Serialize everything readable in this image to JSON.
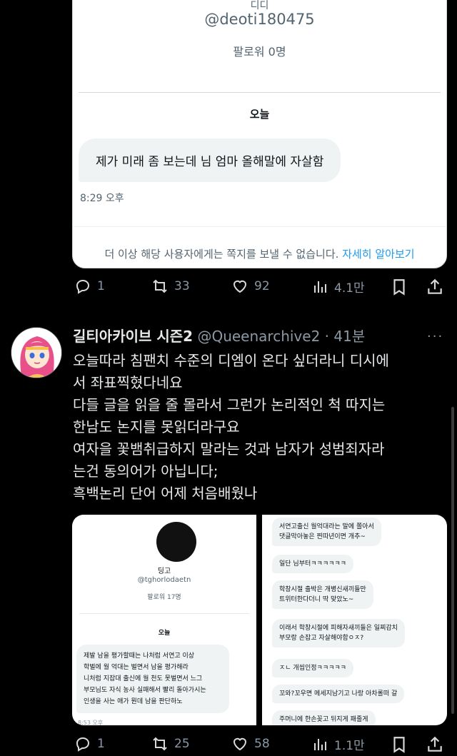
{
  "first_dm_card": {
    "name": "디디",
    "handle": "@deoti180475",
    "followers": "팔로워 0명",
    "day_label": "오늘",
    "message": "제가 미래 좀 보는데 님 엄마 올해말에 자살함",
    "time": "8:29 오후",
    "notice": "더 이상 해당 사용자에게는 쪽지를 보낼 수 없습니다.",
    "learn_more": "자세히 알아보기"
  },
  "first_actions": {
    "replies": "1",
    "reposts": "33",
    "likes": "92",
    "views": "4.1만"
  },
  "tweet": {
    "author": "길티아카이브 시즌2",
    "handle": "@Queenarchive2",
    "dot": "·",
    "ago": "41분",
    "more": "···",
    "lines": [
      "오늘따라 침팬치 수준의 디엠이 온다 싶더라니 디시에",
      "서 좌표찍혔다네요",
      "다들 글을 읽을 줄 몰라서 그런가 논리적인 척 따지는",
      "한남도 논지를 못읽더라구요",
      "여자을 꽃뱀취급하지 말라는 것과 남자가 성범죄자라",
      "는건 동의어가 아닙니다;",
      "흑백논리 단어 어제 처음배웠나"
    ]
  },
  "left_image": {
    "name": "딩고",
    "handle": "@tghorlodaetn",
    "followers": "팔로워 17명",
    "day_label": "오늘",
    "message_lines": [
      "제발 남을 평가할때는 나처럼 서연고 이상",
      "학벌에 월 억대는 벌면서 남을 평가해라",
      "니처럼 지잡대 출신에 월 천도 못벌면서 느그",
      "부모님도 자식 농사 실패해서 빨리 돌아가시는",
      "인생을 사는 애가 뭔데 남을 판단하노"
    ],
    "time": "8:53 오후"
  },
  "right_image": {
    "messages": [
      "서연고출신 월억대라는 말에 쫄아서\n댓글막아놓은 찐따년이면 개추~",
      "일단 님부터ㅋㅋㅋㅋㅋㅋ",
      "학창시절 출박은 개병신새끼들만\n트위터한다더니 딱 맞았노~",
      "이래서 학창시절에 피해자새끼들은 일찌감치\n부모랑 손잡고 자살해야함ㅇㅈ?",
      "ㅈㄴ 개씹인정ㅋㅋㅋㅋㅋ",
      "꼬와?꼬우면 메세지남기고 나랑 아차롤떠 갈",
      "주머니에 한손꽂고 뒤지게 패줄게"
    ]
  },
  "second_actions": {
    "replies": "1",
    "reposts": "25",
    "likes": "58",
    "views": "1.1만"
  },
  "colors": {
    "background": "#000000",
    "text": "#e7e9ea",
    "muted": "#8b98a5",
    "link": "#1d9bf0"
  }
}
